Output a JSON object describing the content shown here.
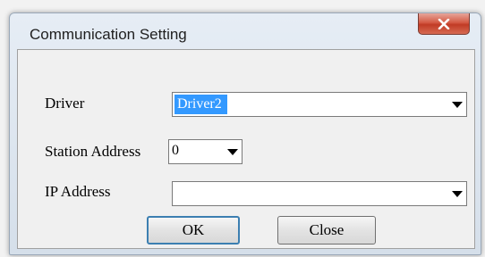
{
  "window": {
    "title": "Communication Setting"
  },
  "form": {
    "driver": {
      "label": "Driver",
      "value": "Driver2"
    },
    "station": {
      "label": "Station Address",
      "value": "0"
    },
    "ip": {
      "label": "IP Address",
      "value": ""
    }
  },
  "buttons": {
    "ok": "OK",
    "close": "Close"
  },
  "icons": {
    "close": "close-icon",
    "dropdown": "chevron-down-icon"
  },
  "colors": {
    "selection": "#3399ff",
    "close_button": "#c13b25"
  }
}
